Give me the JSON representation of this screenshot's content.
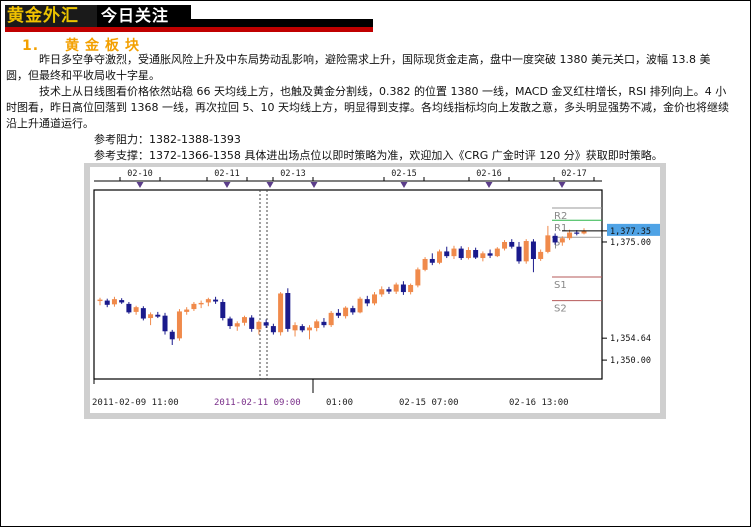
{
  "header": {
    "brand_part1": "黄金",
    "brand_part2": "外汇",
    "section": "今日关注"
  },
  "section": {
    "number": "1.",
    "title": "黄金板块"
  },
  "paragraphs": [
    "昨日多空争夺激烈，受通胀风险上升及中东局势动乱影响，避险需求上升，国际现货金走高，盘中一度突破 1380 美元关口，波幅 13.8 美圆，但最终和平收局收十字星。",
    "技术上从日线图看价格依然站稳 66 天均线上方，也触及黄金分割线，0.382 的位置 1380 一线，MACD 金叉红柱增长，RSI 排列向上。4 小时图看，昨日高位回落到 1368 一线，再次拉回 5、10 天均线上方，明显得到支撑。各均线指标均向上发散之意，多头明显强势不减，金价也将继续沿上升通道运行。"
  ],
  "references": {
    "resistance": "参考阻力：1382-1388-1393",
    "support": "参考支撑：1372-1366-1358 具体进出场点位以即时策略为准，欢迎加入《CRG 广金时评 120 分》获取即时策略。"
  },
  "chart_data": {
    "type": "candlestick",
    "top_dates": [
      "02-10",
      "02-11",
      "02-13",
      "02-15",
      "02-16",
      "02-17"
    ],
    "bottom_labels": [
      "2011-02-09 11:00",
      "2011-02-11 09:00",
      "01:00",
      "02-15 07:00",
      "02-16 13:00"
    ],
    "y_tick_labels": [
      "1,377.35",
      "1,375.00",
      "1,354.64",
      "1,350.00"
    ],
    "pivot_labels": [
      "R2",
      "R1",
      "P",
      "S1",
      "S2"
    ],
    "ylim": [
      1346,
      1386
    ],
    "current_price": 1377.35,
    "low_marker": 1354.64,
    "colors": {
      "up": "#f08a4b",
      "down": "#1a1a8c",
      "highlight": "#4fa3e6",
      "r1": "#2db54a"
    },
    "candles": [
      [
        1362.5,
        1363.2,
        1361.6,
        1362.8
      ],
      [
        1362.6,
        1363.0,
        1361.2,
        1361.7
      ],
      [
        1361.8,
        1363.4,
        1361.3,
        1362.9
      ],
      [
        1362.7,
        1363.1,
        1361.9,
        1362.2
      ],
      [
        1361.9,
        1362.3,
        1359.8,
        1360.1
      ],
      [
        1360.2,
        1361.5,
        1359.6,
        1361.2
      ],
      [
        1361.0,
        1361.4,
        1358.4,
        1358.8
      ],
      [
        1358.9,
        1360.1,
        1357.4,
        1359.7
      ],
      [
        1359.6,
        1360.2,
        1358.9,
        1359.2
      ],
      [
        1359.4,
        1360.0,
        1355.4,
        1356.1
      ],
      [
        1356.0,
        1356.4,
        1353.2,
        1354.4
      ],
      [
        1354.6,
        1360.8,
        1354.1,
        1360.3
      ],
      [
        1360.2,
        1361.2,
        1359.6,
        1360.7
      ],
      [
        1360.8,
        1362.3,
        1360.4,
        1361.9
      ],
      [
        1361.8,
        1362.6,
        1361.0,
        1362.1
      ],
      [
        1362.2,
        1363.2,
        1361.4,
        1362.9
      ],
      [
        1362.8,
        1363.4,
        1361.9,
        1362.4
      ],
      [
        1362.3,
        1362.9,
        1358.4,
        1358.9
      ],
      [
        1358.8,
        1359.2,
        1356.6,
        1357.2
      ],
      [
        1357.1,
        1358.2,
        1356.2,
        1357.8
      ],
      [
        1357.9,
        1359.4,
        1357.3,
        1359.1
      ],
      [
        1359.0,
        1359.5,
        1356.0,
        1356.6
      ],
      [
        1356.5,
        1358.4,
        1355.4,
        1358.1
      ],
      [
        1358.0,
        1358.6,
        1356.8,
        1357.3
      ],
      [
        1357.2,
        1357.7,
        1355.4,
        1355.9
      ],
      [
        1355.9,
        1364.4,
        1355.2,
        1364.1
      ],
      [
        1364.2,
        1365.2,
        1356.0,
        1356.6
      ],
      [
        1356.3,
        1358.0,
        1355.0,
        1357.4
      ],
      [
        1357.2,
        1357.6,
        1355.9,
        1356.3
      ],
      [
        1356.3,
        1357.4,
        1354.4,
        1356.9
      ],
      [
        1356.8,
        1358.6,
        1356.1,
        1358.2
      ],
      [
        1358.1,
        1358.9,
        1356.9,
        1357.4
      ],
      [
        1357.4,
        1360.4,
        1357.0,
        1360.0
      ],
      [
        1360.0,
        1360.8,
        1358.9,
        1359.4
      ],
      [
        1359.3,
        1361.4,
        1358.8,
        1361.1
      ],
      [
        1361.0,
        1361.5,
        1359.6,
        1360.1
      ],
      [
        1360.1,
        1363.4,
        1359.9,
        1363.0
      ],
      [
        1362.9,
        1363.6,
        1361.4,
        1362.0
      ],
      [
        1362.0,
        1364.4,
        1361.6,
        1363.9
      ],
      [
        1363.9,
        1365.6,
        1363.4,
        1365.0
      ],
      [
        1365.0,
        1365.5,
        1364.0,
        1364.5
      ],
      [
        1364.5,
        1366.4,
        1364.0,
        1366.0
      ],
      [
        1366.0,
        1366.7,
        1363.8,
        1364.4
      ],
      [
        1364.4,
        1366.2,
        1363.9,
        1365.9
      ],
      [
        1365.8,
        1369.6,
        1365.4,
        1369.2
      ],
      [
        1369.1,
        1371.8,
        1368.8,
        1371.4
      ],
      [
        1371.4,
        1372.6,
        1370.1,
        1370.6
      ],
      [
        1370.6,
        1373.4,
        1370.3,
        1373.0
      ],
      [
        1373.0,
        1374.0,
        1371.6,
        1372.0
      ],
      [
        1372.0,
        1374.2,
        1371.4,
        1373.6
      ],
      [
        1373.6,
        1374.1,
        1371.2,
        1371.6
      ],
      [
        1371.6,
        1373.9,
        1371.3,
        1373.3
      ],
      [
        1373.3,
        1373.8,
        1371.4,
        1371.7
      ],
      [
        1371.6,
        1373.0,
        1370.9,
        1372.6
      ],
      [
        1372.6,
        1373.4,
        1371.6,
        1372.1
      ],
      [
        1372.0,
        1373.9,
        1371.8,
        1373.6
      ],
      [
        1373.6,
        1375.4,
        1373.2,
        1375.0
      ],
      [
        1375.0,
        1375.6,
        1373.6,
        1374.0
      ],
      [
        1374.0,
        1375.0,
        1370.4,
        1370.9
      ],
      [
        1370.9,
        1375.6,
        1370.4,
        1375.2
      ],
      [
        1375.1,
        1375.6,
        1368.6,
        1371.4
      ],
      [
        1371.4,
        1373.4,
        1371.0,
        1372.9
      ],
      [
        1372.9,
        1378.4,
        1372.6,
        1376.4
      ],
      [
        1376.3,
        1376.8,
        1374.4,
        1374.9
      ],
      [
        1374.9,
        1376.2,
        1374.2,
        1375.8
      ],
      [
        1375.8,
        1377.6,
        1375.4,
        1377.0
      ],
      [
        1377.0,
        1377.5,
        1376.4,
        1376.8
      ],
      [
        1376.8,
        1377.9,
        1376.6,
        1377.35
      ]
    ]
  }
}
